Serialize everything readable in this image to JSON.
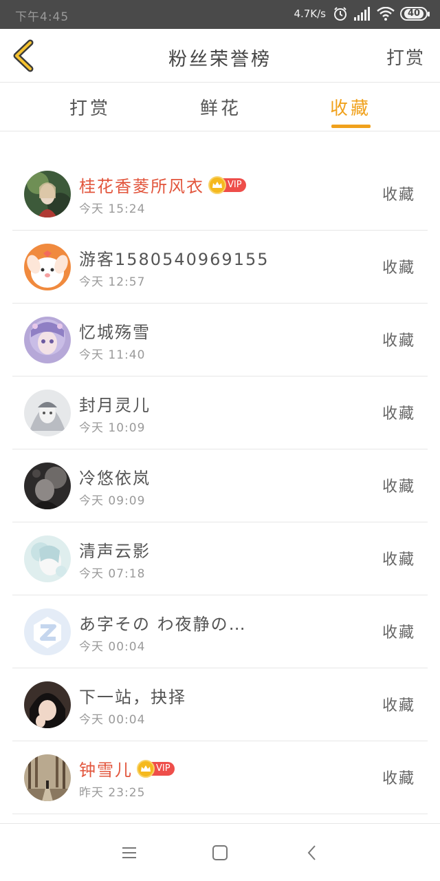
{
  "status_bar": {
    "time": "下午4:45",
    "network_speed": "4.7K/s",
    "battery": "40",
    "icons": [
      "alarm-icon",
      "signal-icon",
      "wifi-icon",
      "battery-icon"
    ]
  },
  "header": {
    "title": "粉丝荣誉榜",
    "right_link": "打赏",
    "back_icon": "chevron-left-icon"
  },
  "tabs": [
    {
      "label": "打赏",
      "active": false
    },
    {
      "label": "鲜花",
      "active": false
    },
    {
      "label": "收藏",
      "active": true
    }
  ],
  "colors": {
    "accent": "#f0a11c",
    "vip_name": "#e2553c",
    "vip_badge": "#ee4e4a",
    "status_bar": "#4a4a4a"
  },
  "fans": [
    {
      "name": "桂花香菱所风衣",
      "vip": true,
      "vip_label": "VIP",
      "time": "今天 15:24",
      "action": "收藏"
    },
    {
      "name": "游客1580540969155",
      "vip": false,
      "time": "今天 12:57",
      "action": "收藏"
    },
    {
      "name": "忆城殇雪",
      "vip": false,
      "time": "今天 11:40",
      "action": "收藏"
    },
    {
      "name": "封月灵儿",
      "vip": false,
      "time": "今天 10:09",
      "action": "收藏"
    },
    {
      "name": "冷悠依岚",
      "vip": false,
      "time": "今天 09:09",
      "action": "收藏"
    },
    {
      "name": "清声云影",
      "vip": false,
      "time": "今天 07:18",
      "action": "收藏"
    },
    {
      "name": "あ字その わ夜静の…",
      "vip": false,
      "time": "今天 00:04",
      "action": "收藏"
    },
    {
      "name": "下一站，抉择",
      "vip": false,
      "time": "今天 00:04",
      "action": "收藏"
    },
    {
      "name": "钟雪儿",
      "vip": true,
      "vip_label": "VIP",
      "time": "昨天 23:25",
      "action": "收藏"
    }
  ],
  "nav_bar": {
    "icons": [
      "menu-icon",
      "home-square-icon",
      "back-triangle-icon"
    ]
  }
}
